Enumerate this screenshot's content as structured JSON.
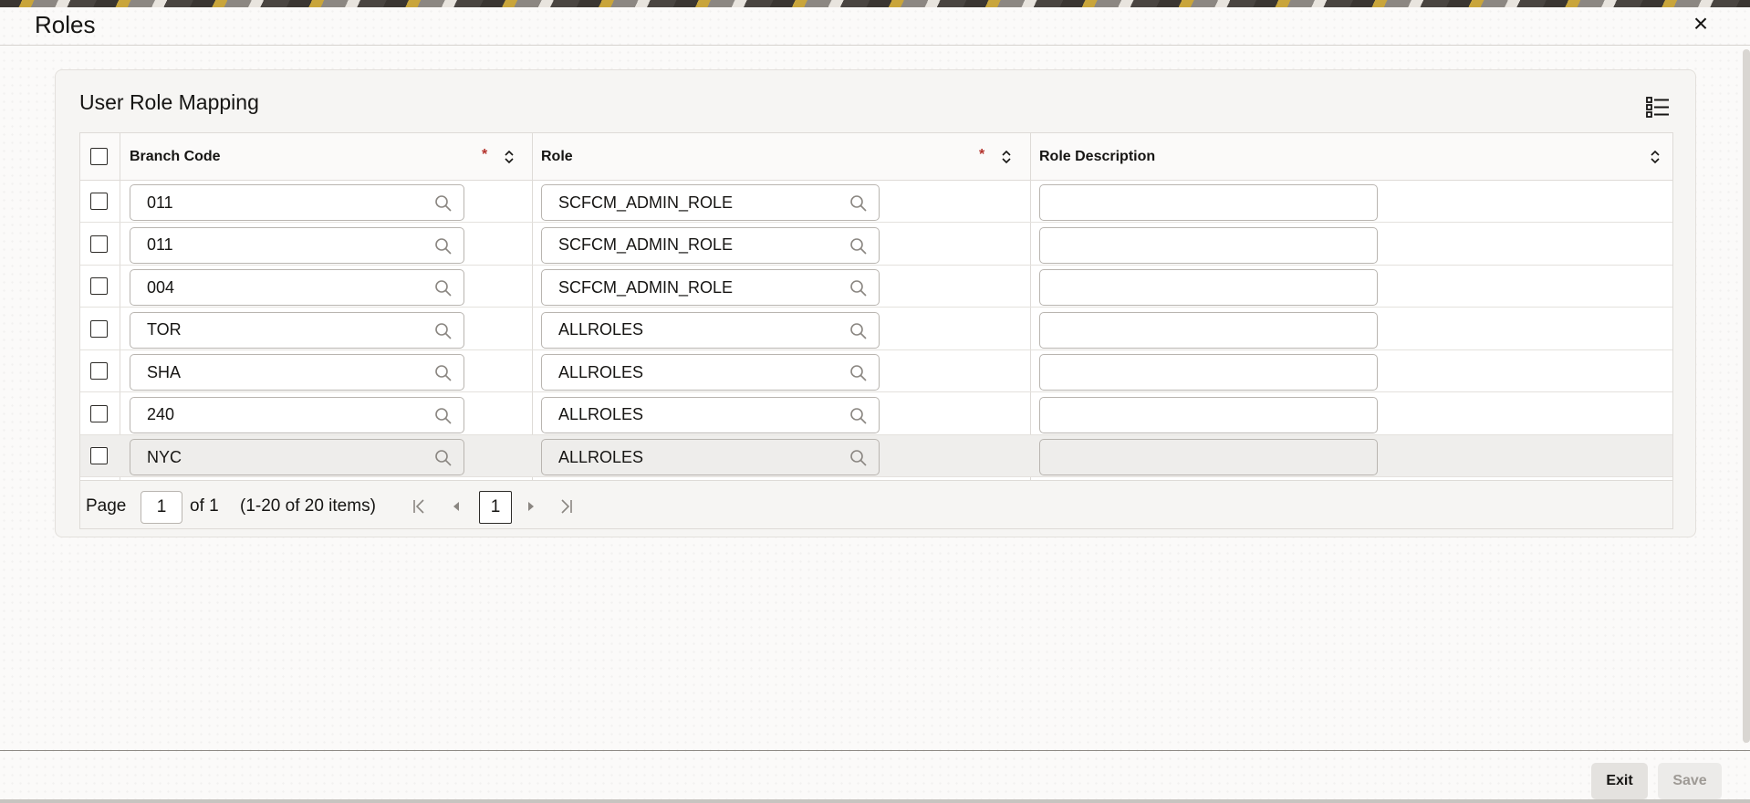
{
  "dialog": {
    "title": "Roles",
    "close_label": "×",
    "exit_label": "Exit",
    "save_label": "Save"
  },
  "panel": {
    "title": "User Role Mapping",
    "columns": [
      {
        "label": "Branch Code",
        "required": true
      },
      {
        "label": "Role",
        "required": true
      },
      {
        "label": "Role Description",
        "required": false
      }
    ],
    "required_mark": "*",
    "rows": [
      {
        "branch": "011",
        "role": "SCFCM_ADMIN_ROLE",
        "description": "",
        "selected": false
      },
      {
        "branch": "011",
        "role": "SCFCM_ADMIN_ROLE",
        "description": "",
        "selected": false
      },
      {
        "branch": "004",
        "role": "SCFCM_ADMIN_ROLE",
        "description": "",
        "selected": false
      },
      {
        "branch": "TOR",
        "role": "ALLROLES",
        "description": "",
        "selected": false
      },
      {
        "branch": "SHA",
        "role": "ALLROLES",
        "description": "",
        "selected": false
      },
      {
        "branch": "240",
        "role": "ALLROLES",
        "description": "",
        "selected": false
      },
      {
        "branch": "NYC",
        "role": "ALLROLES",
        "description": "",
        "selected": true
      }
    ]
  },
  "pager": {
    "page_label": "Page",
    "page_value": "1",
    "of_label": "of 1",
    "items_label": "(1-20 of 20 items)",
    "current_page": "1"
  },
  "colors": {
    "accent_required": "#b3312b",
    "text": "#161513"
  },
  "icons": {
    "close": "close-icon",
    "list": "list-view-icon",
    "search": "search-icon",
    "sort": "sort-icon",
    "first": "first-page-icon",
    "prev": "previous-page-icon",
    "next": "next-page-icon",
    "last": "last-page-icon"
  }
}
